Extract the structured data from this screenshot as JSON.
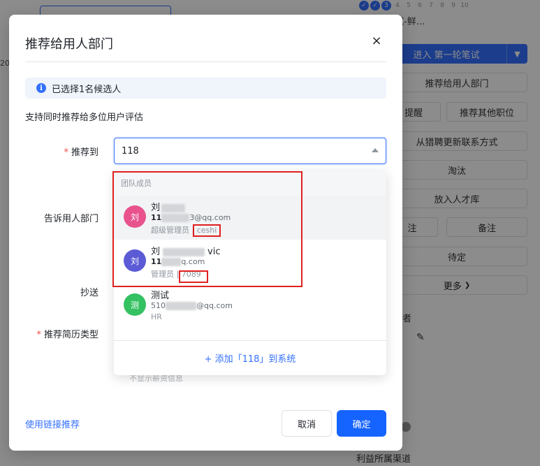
{
  "background": {
    "left_fragment": "20",
    "steps": [
      "3",
      "4",
      "5",
      "6",
      "7",
      "8",
      "9",
      "10"
    ],
    "title_fragment": "试-鲜...",
    "primary_button": "进入 第一轮笔试",
    "buttons": {
      "recommend_dept": "推荐给用人部门",
      "remind": "提醒",
      "recommend_other": "推荐其他职位",
      "update_contact": "从猎聘更新联系方式",
      "eliminate": "淘汰",
      "talent_pool": "放入人才库",
      "note_left": "注",
      "note": "备注",
      "pending": "待定",
      "more": "更多",
      "more_chevron": "❯"
    },
    "owner_fragment": "者",
    "channel_fragment": "利益所属渠道"
  },
  "dialog": {
    "title": "推荐给用人部门",
    "close": "×",
    "notice": "已选择1名候选人",
    "hint": "支持同时推荐给多位用户评估",
    "labels": {
      "recommend_to": "推荐到",
      "tell_dept": "告诉用人部门",
      "cc": "抄送",
      "resume_type": "推荐简历类型"
    },
    "required_mark": "*",
    "select_value": "118",
    "faded_option": "不显示薪资信息",
    "dropdown": {
      "group": "团队成员",
      "options": [
        {
          "avatar": "刘",
          "name": "刘",
          "email_prefix": "11",
          "email_suffix": "3@qq.com",
          "role": "超级管理员",
          "tag": "ceshi",
          "color": "#e8538e"
        },
        {
          "avatar": "刘",
          "name": "刘",
          "name_suffix": "vic",
          "email_prefix": "11",
          "email_suffix": "q.com",
          "role": "管理员",
          "tag": "7089",
          "color": "#5b5bd6"
        },
        {
          "avatar": "测",
          "name": "测试",
          "email_prefix": "510",
          "email_suffix": "@qq.com",
          "role": "HR",
          "tag": "",
          "color": "#34c162"
        }
      ],
      "add_action": "+ 添加「118」到系统"
    },
    "footer": {
      "link": "使用链接推荐",
      "cancel": "取消",
      "confirm": "确定"
    }
  }
}
